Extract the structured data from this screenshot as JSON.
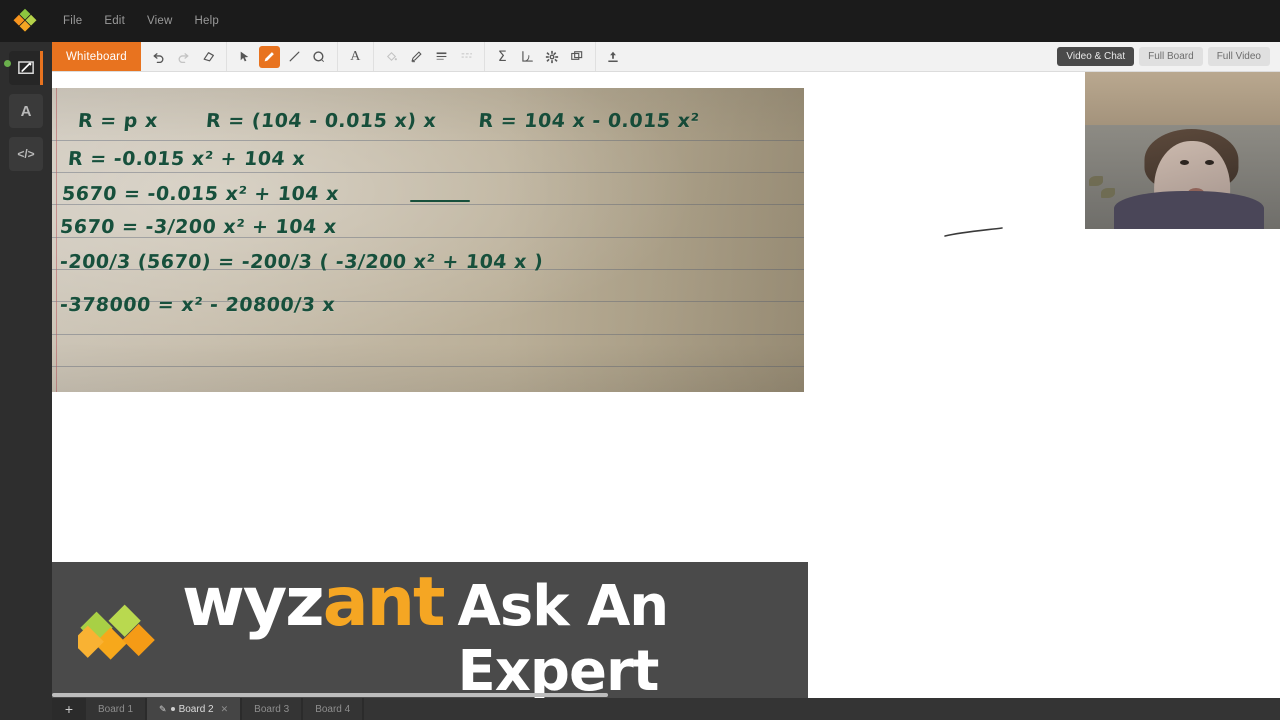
{
  "app": {
    "title": "Wyzant Whiteboard"
  },
  "menubar": {
    "items": [
      {
        "label": "File"
      },
      {
        "label": "Edit"
      },
      {
        "label": "View"
      },
      {
        "label": "Help"
      }
    ]
  },
  "left_rail": {
    "items": [
      {
        "name": "whiteboard",
        "glyph": "✎",
        "active": true
      },
      {
        "name": "text",
        "glyph": "A",
        "active": false
      },
      {
        "name": "code",
        "glyph": "</>",
        "active": false
      }
    ]
  },
  "toolbar": {
    "whiteboard_tab": "Whiteboard",
    "groups": [
      {
        "name": "history",
        "tools": [
          {
            "name": "undo-icon",
            "glyph": "↶",
            "state": "enabled"
          },
          {
            "name": "redo-icon",
            "glyph": "↷",
            "state": "disabled"
          },
          {
            "name": "eraser-icon",
            "glyph": "▱",
            "state": "enabled"
          }
        ]
      },
      {
        "name": "draw",
        "tools": [
          {
            "name": "select-cursor-icon",
            "glyph": "➤",
            "state": "enabled"
          },
          {
            "name": "pencil-icon",
            "glyph": "✏",
            "state": "active"
          },
          {
            "name": "line-icon",
            "glyph": "╱",
            "state": "enabled"
          },
          {
            "name": "ellipse-icon",
            "glyph": "◯",
            "state": "enabled"
          }
        ]
      },
      {
        "name": "text",
        "tools": [
          {
            "name": "text-tool-icon",
            "glyph": "A",
            "state": "enabled"
          }
        ]
      },
      {
        "name": "style",
        "tools": [
          {
            "name": "fill-bucket-icon",
            "glyph": "⬦",
            "state": "disabled"
          },
          {
            "name": "stroke-color-icon",
            "glyph": "✎",
            "state": "enabled"
          },
          {
            "name": "line-weight-icon",
            "glyph": "≡",
            "state": "enabled"
          },
          {
            "name": "dash-style-icon",
            "glyph": "⋯",
            "state": "disabled"
          }
        ]
      },
      {
        "name": "insert",
        "tools": [
          {
            "name": "equation-sigma-icon",
            "glyph": "Σ",
            "state": "enabled"
          },
          {
            "name": "graph-axes-icon",
            "glyph": "⌐",
            "state": "enabled"
          },
          {
            "name": "settings-gear-icon",
            "glyph": "✹",
            "state": "enabled"
          },
          {
            "name": "layers-icon",
            "glyph": "❐",
            "state": "enabled"
          }
        ]
      },
      {
        "name": "upload",
        "tools": [
          {
            "name": "upload-icon",
            "glyph": "⬆",
            "state": "enabled"
          }
        ]
      }
    ],
    "view_buttons": [
      {
        "label": "Video & Chat",
        "active": true
      },
      {
        "label": "Full Board",
        "active": false
      },
      {
        "label": "Full Video",
        "active": false
      }
    ]
  },
  "canvas": {
    "paper_note": {
      "alt": "photo of handwritten algebra work on ruled notebook paper",
      "ink_color": "#17503c",
      "lines": [
        {
          "id": "l1",
          "segments": [
            "R = p x",
            "R = (104 - 0.015 x) x",
            "R = 104 x - 0.015 x²"
          ]
        },
        {
          "id": "l2",
          "segments": [
            "R = -0.015 x² + 104 x"
          ]
        },
        {
          "id": "l3",
          "segments": [
            "5670 = -0.015 x² + 104 x"
          ]
        },
        {
          "id": "l4",
          "segments": [
            "5670 = -3/200 x² + 104 x"
          ]
        },
        {
          "id": "l5",
          "segments": [
            "-200/3 (5670) = -200/3 ( -3/200 x² + 104 x )"
          ]
        },
        {
          "id": "l6",
          "segments": [
            "-378000 = x² - 20800/3 x"
          ]
        }
      ]
    },
    "freehand_stroke": {
      "name": "hand-drawn-line",
      "color": "#3a3a3a"
    },
    "video_panel": {
      "label": "tutor webcam feed"
    }
  },
  "banner": {
    "brand_primary": "wyz",
    "brand_accent": "ant",
    "tagline": "Ask An Expert",
    "accent_color": "#f5a623",
    "background_color": "#4a4a4a"
  },
  "tabbar": {
    "add_label": "+",
    "tabs": [
      {
        "label": "Board 1",
        "active": false,
        "closable": false
      },
      {
        "label": "Board 2",
        "active": true,
        "closable": true
      },
      {
        "label": "Board 3",
        "active": false,
        "closable": false
      },
      {
        "label": "Board 4",
        "active": false,
        "closable": false
      }
    ]
  }
}
